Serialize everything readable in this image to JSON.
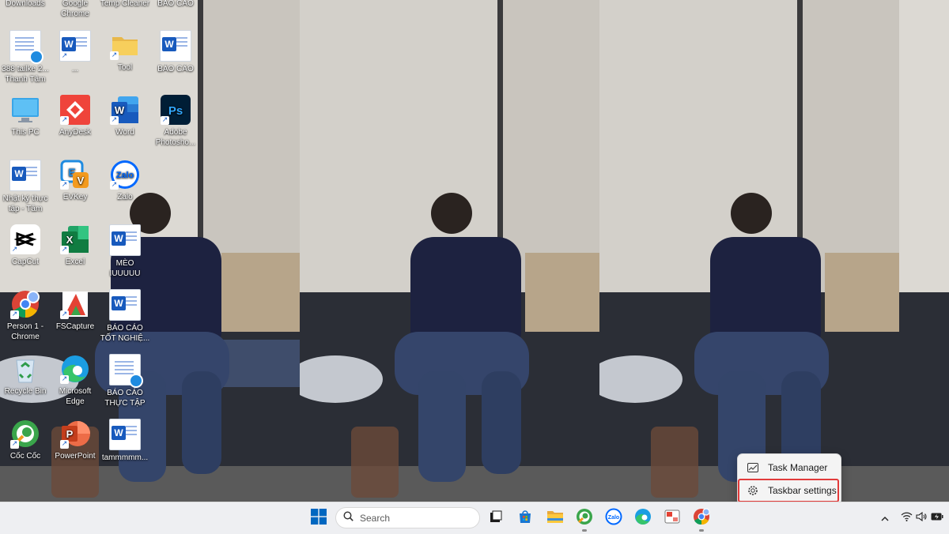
{
  "desktop": {
    "icons": [
      {
        "id": "downloads",
        "label": "Downloads"
      },
      {
        "id": "chrome-top",
        "label": "Google Chrome"
      },
      {
        "id": "temp-cleaner",
        "label": "Temp Cleaner"
      },
      {
        "id": "bao-cao-top",
        "label": "BÁO CÁO"
      },
      {
        "id": "doc-388",
        "label": "388 tailke 2... Thanh Tâm"
      },
      {
        "id": "word-dots",
        "label": "..."
      },
      {
        "id": "tool",
        "label": "Tool"
      },
      {
        "id": "bao-cao-2",
        "label": "BÁO CÁO"
      },
      {
        "id": "this-pc",
        "label": "This PC"
      },
      {
        "id": "anydesk",
        "label": "AnyDesk"
      },
      {
        "id": "word",
        "label": "Word"
      },
      {
        "id": "photoshop",
        "label": "Adobe Photosho..."
      },
      {
        "id": "nhat-ky",
        "label": "Nhật ký thực tập - Tâm"
      },
      {
        "id": "evkey",
        "label": "EVKey"
      },
      {
        "id": "zalo",
        "label": "Zalo"
      },
      {
        "id": "capcut",
        "label": "CapCut"
      },
      {
        "id": "excel",
        "label": "Excel"
      },
      {
        "id": "meo",
        "label": "MÈO IUUUUU"
      },
      {
        "id": "person-chrome",
        "label": "Person 1 - Chrome"
      },
      {
        "id": "fscapture",
        "label": "FSCapture"
      },
      {
        "id": "bao-cao-tot-nghiep",
        "label": "BÁO CÁO TỐT NGHIỆ..."
      },
      {
        "id": "recycle-bin",
        "label": "Recycle Bin"
      },
      {
        "id": "edge",
        "label": "Microsoft Edge"
      },
      {
        "id": "bao-cao-thuc-tap",
        "label": "BÁO CÁO THỰC TẬP T..."
      },
      {
        "id": "coccoc",
        "label": "Cốc Cốc"
      },
      {
        "id": "powerpoint",
        "label": "PowerPoint"
      },
      {
        "id": "tammmm",
        "label": "tammmmm..."
      }
    ]
  },
  "context_menu": {
    "task_manager": "Task Manager",
    "taskbar_settings": "Taskbar settings"
  },
  "taskbar": {
    "search_placeholder": "Search",
    "apps": [
      "start",
      "task-view",
      "store",
      "file-explorer",
      "coccoc",
      "zalo",
      "edge",
      "snipping-tool",
      "chrome"
    ],
    "tray": [
      "chevron-up",
      "wifi",
      "volume",
      "battery"
    ]
  },
  "colors": {
    "taskbar_bg": "#eeeff2",
    "highlight_red": "#e23b3b",
    "start_blue": "#0067c0"
  }
}
